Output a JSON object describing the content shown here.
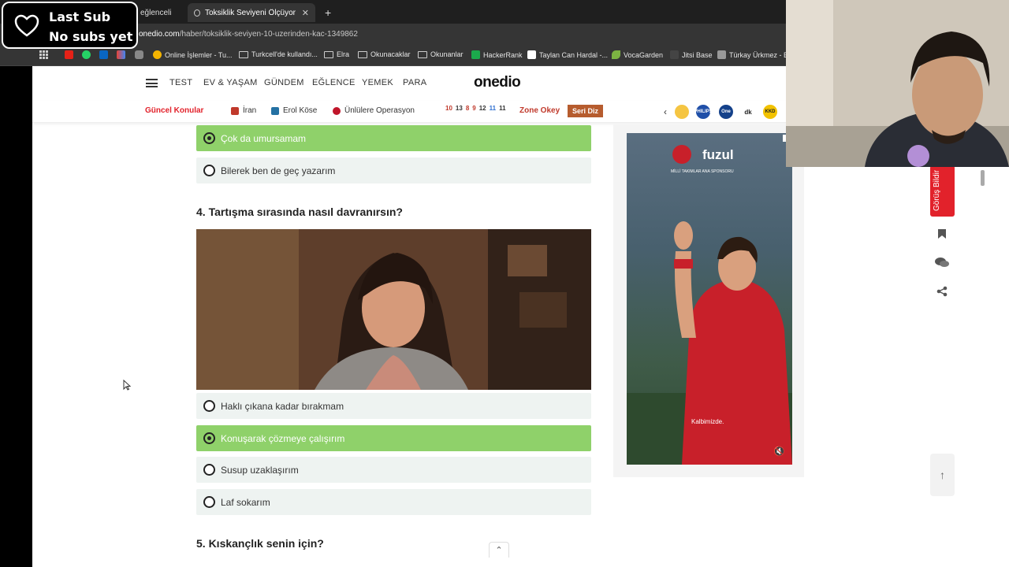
{
  "browser": {
    "tabs": [
      {
        "title": "eğlenceli",
        "active": false
      },
      {
        "title": "Toksiklik Seviyeni Ölçüyoruz! -",
        "active": true
      }
    ],
    "new_tab": "+",
    "url_domain": "onedio.com",
    "url_path": "/haber/toksiklik-seviyen-10-uzerinden-kac-1349862",
    "bookmarks": [
      {
        "label": "Online İşlemler - Tu...",
        "icon": "globe-icon"
      },
      {
        "label": "Turkcell'de kullandı...",
        "icon": "folder-icon"
      },
      {
        "label": "Elra",
        "icon": "folder-icon"
      },
      {
        "label": "Okunacaklar",
        "icon": "folder-icon"
      },
      {
        "label": "Okunanlar",
        "icon": "folder-icon"
      },
      {
        "label": "HackerRank",
        "icon": "hackerrank-icon"
      },
      {
        "label": "Taylan Can Hardal -...",
        "icon": "medium-icon"
      },
      {
        "label": "VocaGarden",
        "icon": "leaf-icon"
      },
      {
        "label": "Jitsi Base",
        "icon": "jitsi-icon"
      },
      {
        "label": "Türkay Ürkmez - Evi",
        "icon": "site-icon"
      }
    ]
  },
  "overlay": {
    "line1": "Last Sub",
    "line2": "No subs yet"
  },
  "nav": {
    "items": [
      "TEST",
      "EV & YAŞAM",
      "GÜNDEM",
      "EĞLENCE",
      "YEMEK",
      "PARA"
    ],
    "logo": "onedio"
  },
  "topics": {
    "label": "Güncel Konular",
    "items": [
      "İran",
      "Erol Köse",
      "Ünlülere Operasyon"
    ],
    "numbers": [
      "10",
      "13",
      "8",
      "9",
      "12",
      "11",
      "11"
    ],
    "zone": "Zone Okey",
    "serie": "Seri Diz",
    "brand_circles": [
      "PHILIPS",
      "One",
      "dk",
      "KKD"
    ]
  },
  "quiz": {
    "prev_options": [
      {
        "text": "Çok da umursamam",
        "selected": true
      },
      {
        "text": "Bilerek ben de geç yazarım",
        "selected": false
      }
    ],
    "q4_title": "4. Tartışma sırasında nasıl davranırsın?",
    "q4_options": [
      {
        "text": "Haklı çıkana kadar bırakmam",
        "selected": false
      },
      {
        "text": "Konuşarak çözmeye çalışırım",
        "selected": true
      },
      {
        "text": "Susup uzaklaşırım",
        "selected": false
      },
      {
        "text": "Laf sokarım",
        "selected": false
      }
    ],
    "q5_title": "5. Kıskançlık senin için?"
  },
  "ad": {
    "brand": "fuzul",
    "subtitle": "MİLLİ TAKIMLAR ANA SPONSORU",
    "caption": "Kalbimizde."
  },
  "side": {
    "feedback": "Görüş Bildir"
  },
  "colors": {
    "selected": "#8fd16a",
    "option_bg": "#eef3f1",
    "topic_label": "#e2222b",
    "zone": "#c0392b",
    "serie_bg": "#b65c2e"
  }
}
